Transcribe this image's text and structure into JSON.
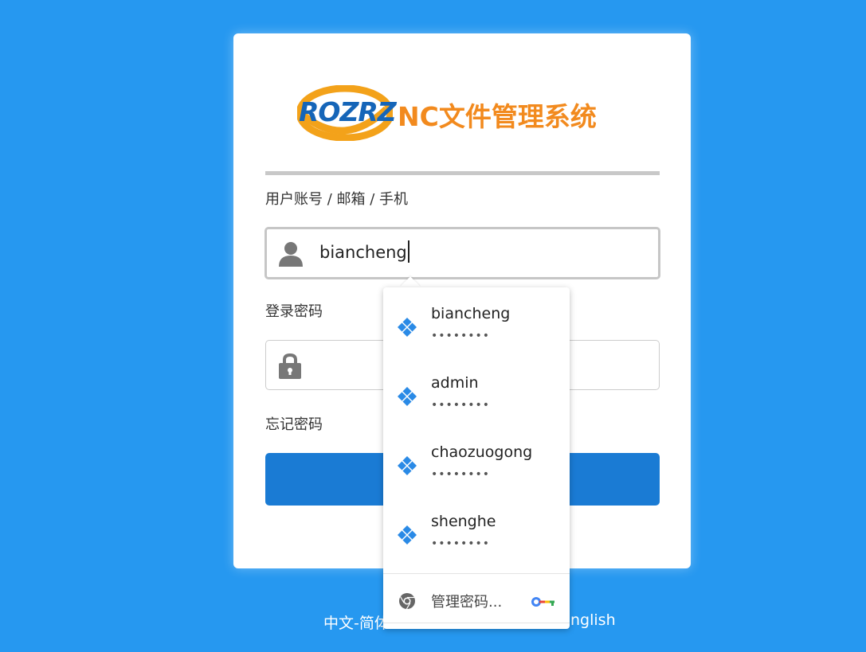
{
  "colors": {
    "background": "#2698f0",
    "brand_blue": "#1565b8",
    "brand_orange": "#f28a1e",
    "button": "#1a7bd4",
    "autofill_icon": "#2a8ae6"
  },
  "logo": {
    "mark": "ROZRZ",
    "title": "NC文件管理系统"
  },
  "form": {
    "username_label": "用户账号 / 邮箱 / 手机",
    "username_value": "biancheng",
    "password_label": "登录密码",
    "password_value": "",
    "forgot_link": "忘记密码",
    "login_button": ""
  },
  "language": {
    "left_visible": "中文-简体",
    "right_visible": "English"
  },
  "autofill": {
    "items": [
      {
        "username": "biancheng",
        "password_mask": "••••••••",
        "icon": "password-key-icon"
      },
      {
        "username": "admin",
        "password_mask": "••••••••",
        "icon": "password-key-icon"
      },
      {
        "username": "chaozuogong",
        "password_mask": "••••••••",
        "icon": "password-key-icon"
      },
      {
        "username": "shenghe",
        "password_mask": "••••••••",
        "icon": "password-key-icon"
      }
    ],
    "manage_label": "管理密码...",
    "manage_icon": "chrome-icon",
    "manage_trailing_icon": "google-password-key-icon"
  }
}
